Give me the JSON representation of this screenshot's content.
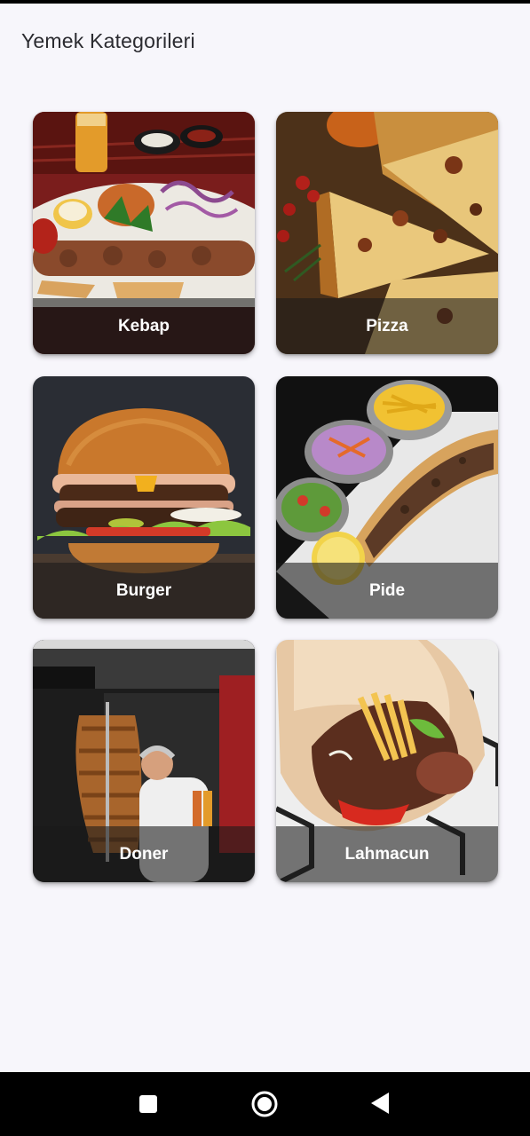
{
  "header": {
    "title": "Yemek Kategorileri"
  },
  "categories": [
    {
      "label": "Kebap"
    },
    {
      "label": "Pizza"
    },
    {
      "label": "Burger"
    },
    {
      "label": "Pide"
    },
    {
      "label": "Doner"
    },
    {
      "label": "Lahmacun"
    }
  ],
  "nav": {
    "recents_icon": "square-icon",
    "home_icon": "circle-icon",
    "back_icon": "triangle-back-icon"
  },
  "colors": {
    "background": "#f7f6fb",
    "label_overlay": "rgba(25,25,25,0.58)",
    "nav_bar": "#000000"
  }
}
